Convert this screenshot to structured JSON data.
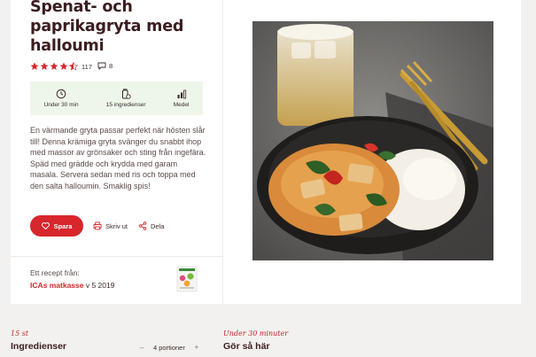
{
  "recipe": {
    "title": "Spenat- och paprikagryta med halloumi",
    "rating_count": "117",
    "comment_count": "8",
    "stars": 4.5,
    "info": [
      {
        "icon": "clock-icon",
        "label": "Under 30 min"
      },
      {
        "icon": "ingredients-icon",
        "label": "15 ingredienser"
      },
      {
        "icon": "difficulty-icon",
        "label": "Medel"
      }
    ],
    "description": "En värmande gryta passar perfekt när hösten slår till! Denna krämiga gryta svänger du snabbt ihop med massor av grönsaker och sting från ingefära. Späd med grädde och krydda med garam masala. Servera sedan med ris och toppa med den salta halloumin. Smaklig spis!",
    "actions": {
      "save_label": "Spara",
      "print_label": "Skriv ut",
      "share_label": "Dela"
    },
    "source": {
      "from_label": "Ett recept från:",
      "name": "ICAs matkasse",
      "week": " v 5 2019"
    }
  },
  "bottom": {
    "ingredients_count": "15 st",
    "ingredients_heading": "Ingredienser",
    "portions": "4 portioner",
    "time_label": "Under 30 minuter",
    "steps_heading": "Gör så här"
  },
  "colors": {
    "accent": "#d7262c",
    "title": "#3b1d1f",
    "info_bg": "#eef6ea"
  }
}
